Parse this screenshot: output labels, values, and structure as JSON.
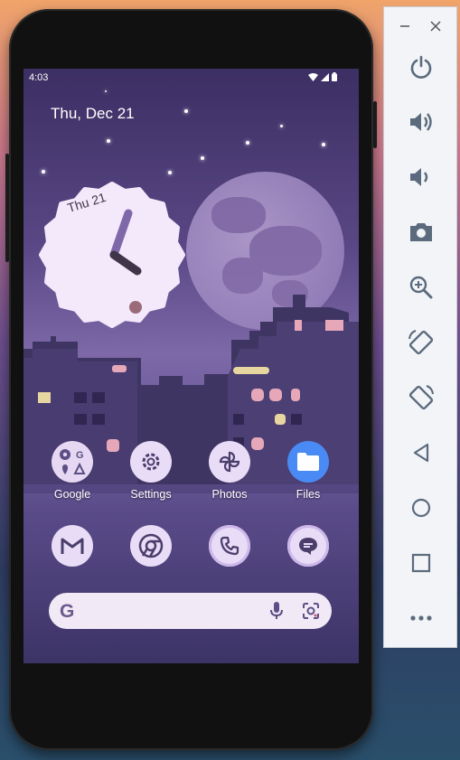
{
  "status_bar": {
    "time": "4:03"
  },
  "home": {
    "date": "Thu, Dec 21",
    "clock_day": "Thu 21",
    "apps_row1": [
      {
        "label": "Google",
        "icon": "google-folder-icon"
      },
      {
        "label": "Settings",
        "icon": "gear-icon"
      },
      {
        "label": "Photos",
        "icon": "pinwheel-icon"
      },
      {
        "label": "Files",
        "icon": "folder-icon"
      }
    ],
    "apps_row2": [
      {
        "icon": "gmail-icon"
      },
      {
        "icon": "chrome-icon"
      },
      {
        "icon": "phone-icon"
      },
      {
        "icon": "messages-icon"
      }
    ],
    "search": {
      "logo": "G"
    }
  },
  "sidebar": {
    "window_controls": [
      "minimize",
      "close"
    ],
    "buttons": [
      "power",
      "volume-up",
      "volume-down",
      "screenshot",
      "zoom",
      "rotate-left",
      "rotate-right",
      "back",
      "home",
      "overview",
      "more"
    ]
  },
  "colors": {
    "accent": "#e9dcf7",
    "files_blue": "#4a8af4",
    "sidebar_icon": "#5b6b7d"
  }
}
